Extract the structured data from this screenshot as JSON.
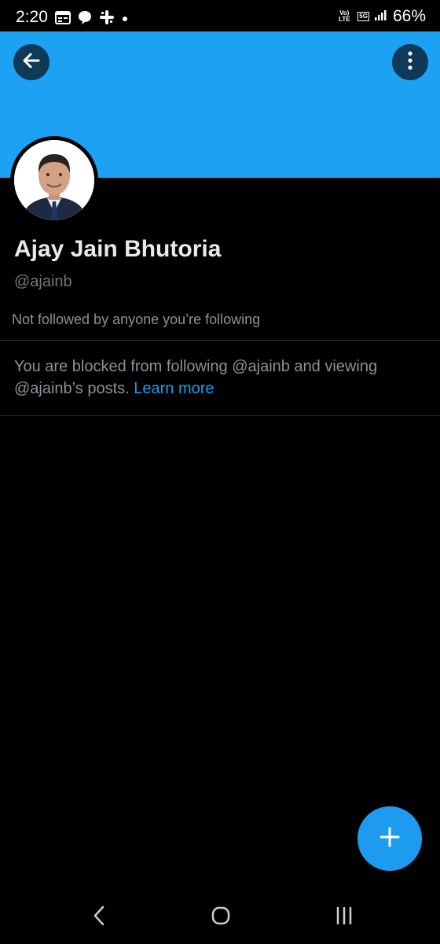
{
  "status_bar": {
    "time": "2:20",
    "battery": "66%",
    "volte_label": "Vo) LTE",
    "network_label": "5G"
  },
  "icons": {
    "back": "arrow-left-icon",
    "more": "more-vertical-icon",
    "compose": "plus-icon",
    "nav_back": "chevron-left-icon",
    "nav_home": "home-circle-icon",
    "nav_recents": "recents-icon"
  },
  "colors": {
    "banner": "#1da1f2",
    "accent": "#1d9bf0",
    "background": "#000000"
  },
  "profile": {
    "display_name": "Ajay Jain Bhutoria",
    "handle": "@ajainb",
    "followed_by": "Not followed by anyone you’re following"
  },
  "blocked": {
    "message": "You are blocked from following @ajainb and viewing @ajainb’s posts.",
    "learn_more": "Learn more"
  }
}
